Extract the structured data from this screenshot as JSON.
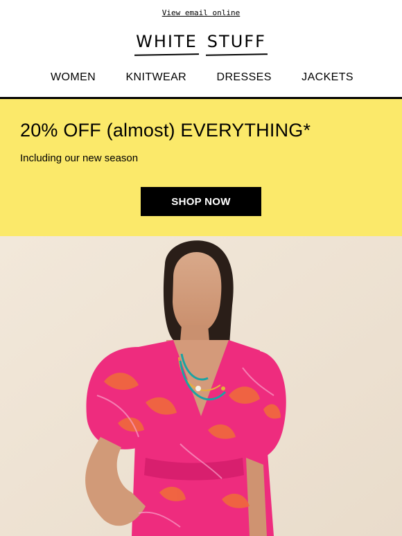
{
  "header": {
    "view_online": "View email online",
    "logo_word_1": "WHITE",
    "logo_word_2": "STUFF"
  },
  "nav": {
    "items": [
      {
        "label": "WOMEN"
      },
      {
        "label": "KNITWEAR"
      },
      {
        "label": "DRESSES"
      },
      {
        "label": "JACKETS"
      }
    ]
  },
  "promo": {
    "headline": "20% OFF (almost) EVERYTHING*",
    "subline": "Including our new season",
    "cta": "SHOP NOW",
    "background": "#fbe96a"
  },
  "hero": {
    "description_icon": "model-in-pink-floral-dress-photo",
    "background": "#efe4d6",
    "dress_color": "#ee2c7e"
  }
}
